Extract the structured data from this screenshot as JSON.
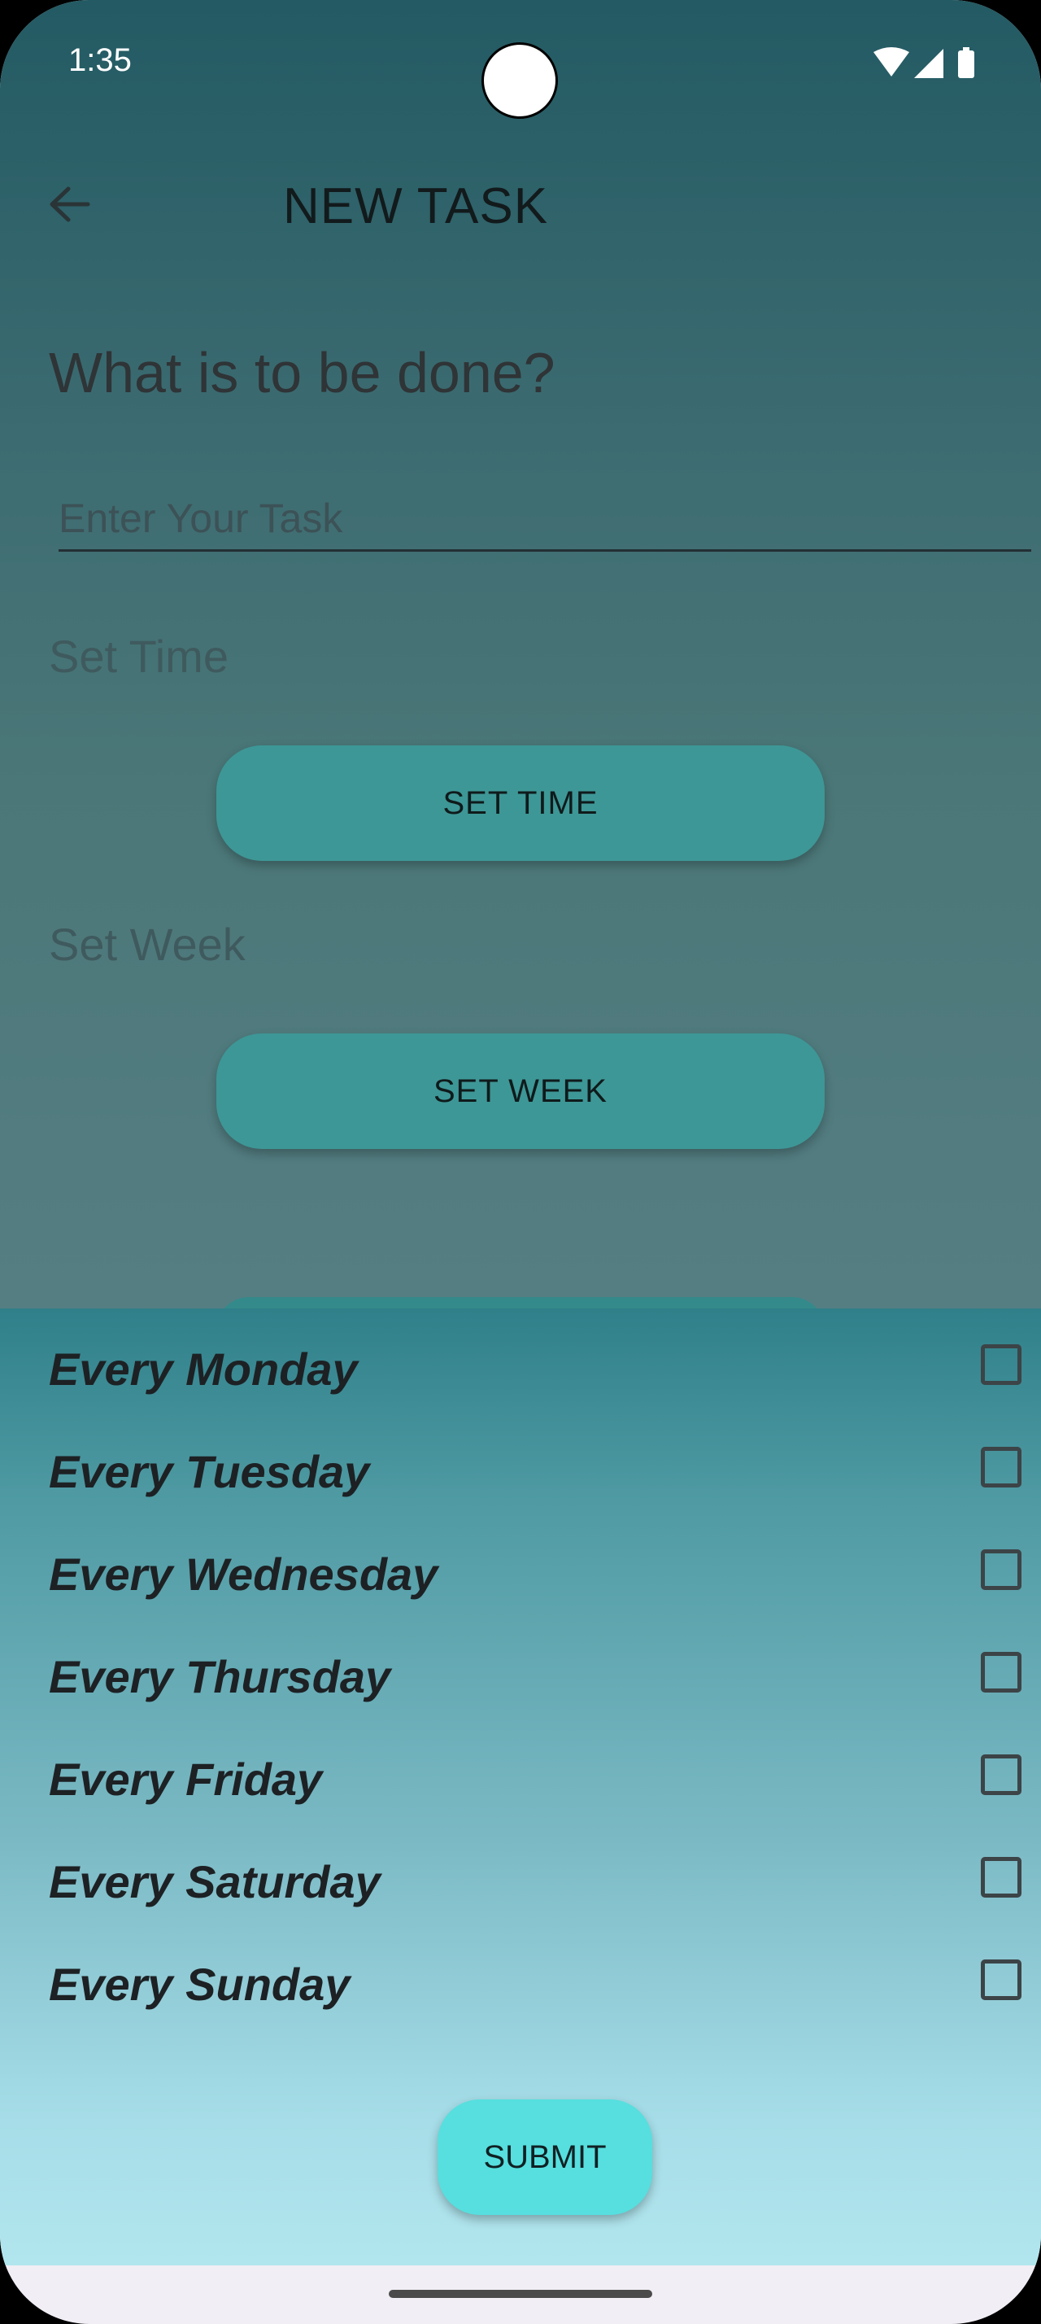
{
  "status_bar": {
    "time": "1:35"
  },
  "app_bar": {
    "title": "NEW TASK"
  },
  "form": {
    "question": "What is to be done?",
    "task_placeholder": "Enter Your Task",
    "set_time_label": "Set Time",
    "set_time_button": "SET TIME",
    "set_week_label": "Set Week",
    "set_week_button": "SET WEEK"
  },
  "week_sheet": {
    "days": [
      {
        "label": "Every Monday",
        "checked": false
      },
      {
        "label": "Every Tuesday",
        "checked": false
      },
      {
        "label": "Every Wednesday",
        "checked": false
      },
      {
        "label": "Every Thursday",
        "checked": false
      },
      {
        "label": "Every Friday",
        "checked": false
      },
      {
        "label": "Every Saturday",
        "checked": false
      },
      {
        "label": "Every Sunday",
        "checked": false
      }
    ],
    "submit_button": "SUBMIT"
  },
  "colors": {
    "header_bg": "#235a63",
    "button": "#3d9796",
    "submit": "#56dfde",
    "sheet_top": "#2f808a",
    "sheet_bottom": "#b2e6ee"
  }
}
